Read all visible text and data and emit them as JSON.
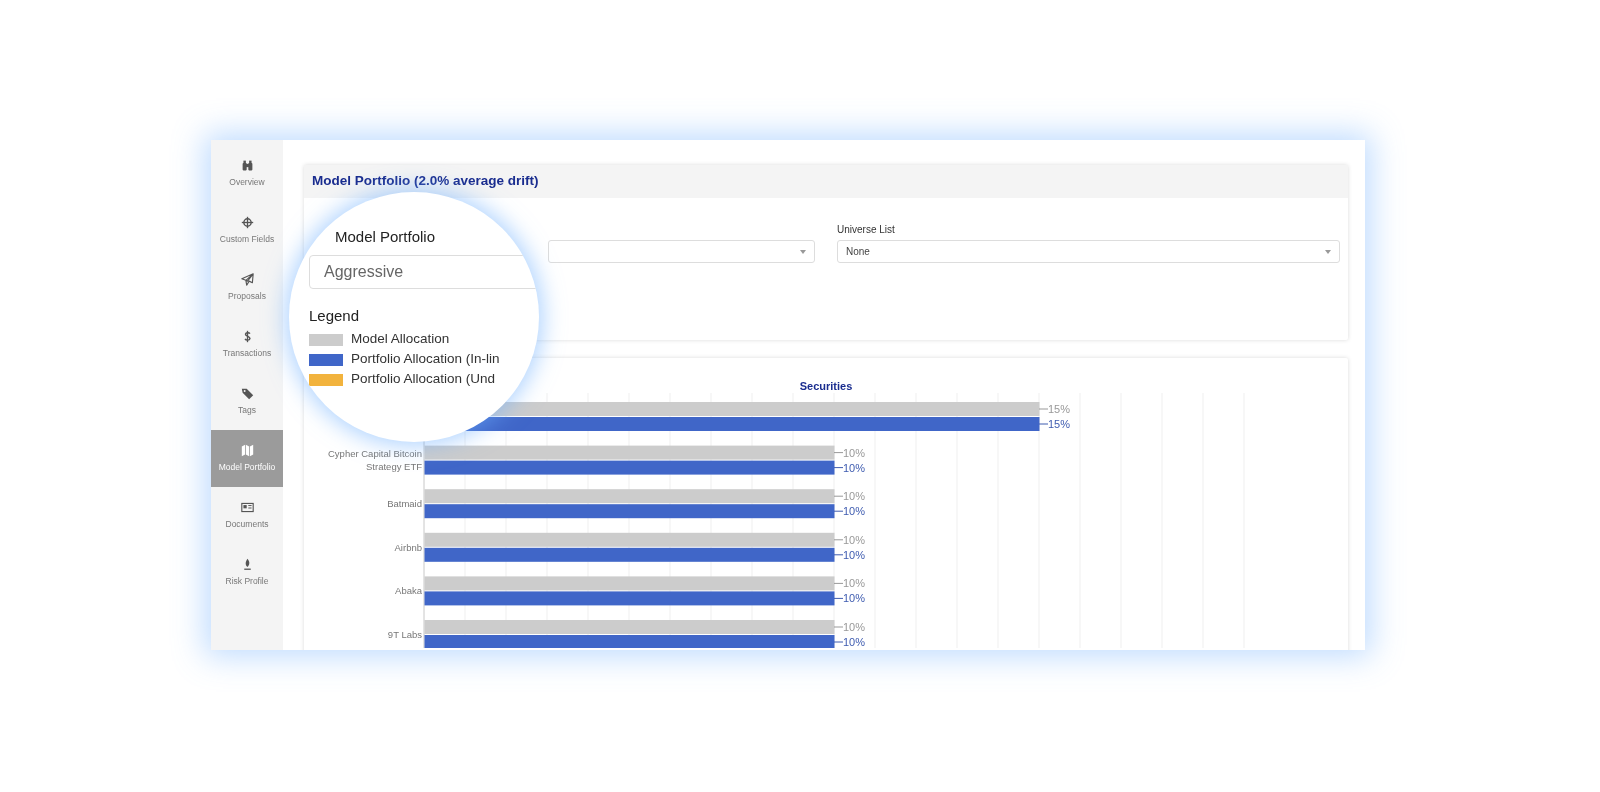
{
  "sidebar": {
    "items": [
      {
        "label": "Overview",
        "selected": false
      },
      {
        "label": "Custom Fields",
        "selected": false
      },
      {
        "label": "Proposals",
        "selected": false
      },
      {
        "label": "Transactions",
        "selected": false
      },
      {
        "label": "Tags",
        "selected": false
      },
      {
        "label": "Model Portfolio",
        "selected": true
      },
      {
        "label": "Documents",
        "selected": false
      },
      {
        "label": "Risk Profile",
        "selected": false
      }
    ]
  },
  "portfolio_card": {
    "title": "Model Portfolio (2.0% average drift)",
    "universe_field": {
      "label": "Universe List",
      "value": "None"
    }
  },
  "securities_card": {
    "chart_data": {
      "type": "bar",
      "orientation": "horizontal",
      "title": "Securities",
      "categories": [
        null,
        "Cypher Capital Bitcoin Strategy ETF",
        "Batmaid",
        "Airbnb",
        "Abaka",
        "9T Labs"
      ],
      "series": [
        {
          "name": "Model Allocation",
          "color": "#cccccc",
          "values": [
            15,
            10,
            10,
            10,
            10,
            10
          ],
          "value_labels": [
            "15%",
            "10%",
            "10%",
            "10%",
            "10%",
            "10%"
          ]
        },
        {
          "name": "Portfolio Allocation (In-lin",
          "color": "#4066c8",
          "values": [
            15,
            10,
            10,
            10,
            10,
            10
          ],
          "value_labels": [
            "15%",
            "10%",
            "10%",
            "10%",
            "10%",
            "10%"
          ]
        },
        {
          "name": "Portfolio Allocation (Und",
          "color": "#f2b33d",
          "values": [
            null,
            null,
            null,
            null,
            null,
            null
          ]
        }
      ],
      "data_labels": true
    }
  },
  "magnifier": {
    "field_label": "Model Portfolio",
    "field_value": "Aggressive",
    "legend_title": "Legend"
  }
}
